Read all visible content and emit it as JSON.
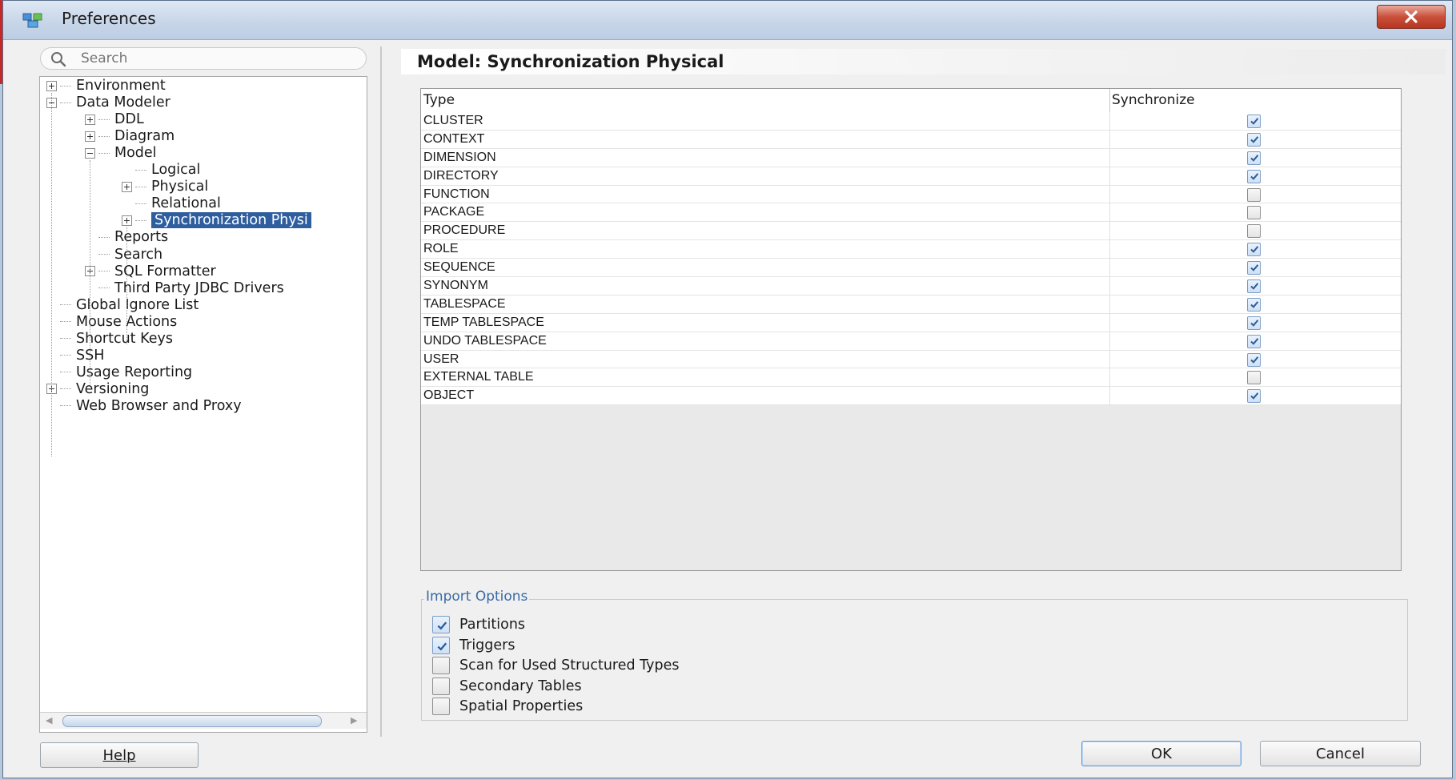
{
  "window": {
    "title": "Preferences"
  },
  "search": {
    "placeholder": "Search"
  },
  "tree": {
    "items": [
      {
        "label": "Environment",
        "level": 0,
        "expander": "plus"
      },
      {
        "label": "Data Modeler",
        "level": 0,
        "expander": "minus"
      },
      {
        "label": "DDL",
        "level": 1,
        "expander": "plus"
      },
      {
        "label": "Diagram",
        "level": 1,
        "expander": "plus"
      },
      {
        "label": "Model",
        "level": 1,
        "expander": "minus"
      },
      {
        "label": "Logical",
        "level": 2,
        "expander": "none"
      },
      {
        "label": "Physical",
        "level": 2,
        "expander": "plus"
      },
      {
        "label": "Relational",
        "level": 2,
        "expander": "none"
      },
      {
        "label": "Synchronization Physi",
        "level": 2,
        "expander": "plus",
        "selected": true
      },
      {
        "label": "Reports",
        "level": 1,
        "expander": "none"
      },
      {
        "label": "Search",
        "level": 1,
        "expander": "none"
      },
      {
        "label": "SQL Formatter",
        "level": 1,
        "expander": "plus"
      },
      {
        "label": "Third Party JDBC Drivers",
        "level": 1,
        "expander": "none"
      },
      {
        "label": "Global Ignore List",
        "level": 0,
        "expander": "none"
      },
      {
        "label": "Mouse Actions",
        "level": 0,
        "expander": "none"
      },
      {
        "label": "Shortcut Keys",
        "level": 0,
        "expander": "none"
      },
      {
        "label": "SSH",
        "level": 0,
        "expander": "none"
      },
      {
        "label": "Usage Reporting",
        "level": 0,
        "expander": "none"
      },
      {
        "label": "Versioning",
        "level": 0,
        "expander": "plus"
      },
      {
        "label": "Web Browser and Proxy",
        "level": 0,
        "expander": "none"
      }
    ]
  },
  "page": {
    "title": "Model: Synchronization Physical"
  },
  "table": {
    "columns": [
      "Type",
      "Synchronize"
    ],
    "rows": [
      {
        "type": "CLUSTER",
        "synchronize": true
      },
      {
        "type": "CONTEXT",
        "synchronize": true
      },
      {
        "type": "DIMENSION",
        "synchronize": true
      },
      {
        "type": "DIRECTORY",
        "synchronize": true
      },
      {
        "type": "FUNCTION",
        "synchronize": false
      },
      {
        "type": "PACKAGE",
        "synchronize": false
      },
      {
        "type": "PROCEDURE",
        "synchronize": false
      },
      {
        "type": "ROLE",
        "synchronize": true
      },
      {
        "type": "SEQUENCE",
        "synchronize": true
      },
      {
        "type": "SYNONYM",
        "synchronize": true
      },
      {
        "type": "TABLESPACE",
        "synchronize": true
      },
      {
        "type": "TEMP TABLESPACE",
        "synchronize": true
      },
      {
        "type": "UNDO TABLESPACE",
        "synchronize": true
      },
      {
        "type": "USER",
        "synchronize": true
      },
      {
        "type": "EXTERNAL TABLE",
        "synchronize": false
      },
      {
        "type": "OBJECT",
        "synchronize": true
      }
    ]
  },
  "import_options": {
    "title": "Import Options",
    "options": [
      {
        "label": "Partitions",
        "checked": true
      },
      {
        "label": "Triggers",
        "checked": true
      },
      {
        "label": "Scan for Used Structured Types",
        "checked": false
      },
      {
        "label": "Secondary Tables",
        "checked": false
      },
      {
        "label": "Spatial Properties",
        "checked": false
      }
    ]
  },
  "buttons": {
    "help": "Help",
    "ok": "OK",
    "cancel": "Cancel"
  },
  "colors": {
    "selection": "#2f5e9f",
    "group_title": "#3a6aa6",
    "close_button": "#c9503b"
  }
}
